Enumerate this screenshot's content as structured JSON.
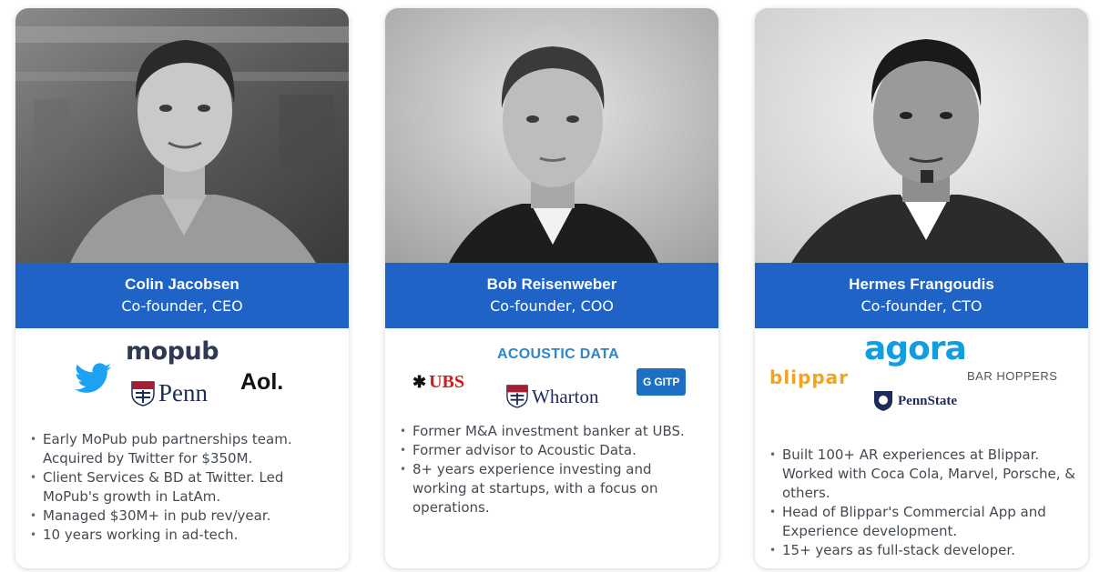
{
  "cards": [
    {
      "name": "Colin Jacobsen",
      "role": "Co-founder, CEO",
      "logos": {
        "mopub": "mopub",
        "penn": "Penn",
        "aol": "Aol."
      },
      "bullets": [
        "Early MoPub pub partnerships team. Acquired by Twitter for $350M.",
        "Client Services & BD at Twitter. Led MoPub's growth in LatAm.",
        "Managed $30M+ in pub rev/year.",
        "10 years working in ad-tech."
      ]
    },
    {
      "name": "Bob Reisenweber",
      "role": "Co-founder, COO",
      "logos": {
        "acoustic": "ACOUSTIC DATA",
        "ubs": "UBS",
        "wharton": "Wharton",
        "gitp": "GITP"
      },
      "bullets": [
        "Former M&A investment banker at UBS.",
        "Former advisor to Acoustic Data.",
        "8+ years experience investing and working at startups, with a focus on operations."
      ]
    },
    {
      "name": "Hermes Frangoudis",
      "role": "Co-founder, CTO",
      "logos": {
        "agora": "agora",
        "blippar": "blippar",
        "barhoppers": "BAR HOPPERS",
        "pennstate": "PennState"
      },
      "bullets": [
        "Built 100+ AR experiences at Blippar. Worked with Coca Cola, Marvel, Porsche, & others.",
        "Head of Blippar's Commercial App and Experience development.",
        "15+ years as full-stack developer."
      ]
    }
  ],
  "colors": {
    "band": "#1f63c6",
    "twitter": "#1da1f2",
    "agora": "#119ee0",
    "blippar": "#f4a31c",
    "ubs": "#d11a1a"
  },
  "icons": [
    "twitter-bird-icon",
    "penn-shield-icon",
    "ubs-keys-icon",
    "wharton-shield-icon",
    "gitp-icon",
    "pennstate-lion-icon"
  ]
}
